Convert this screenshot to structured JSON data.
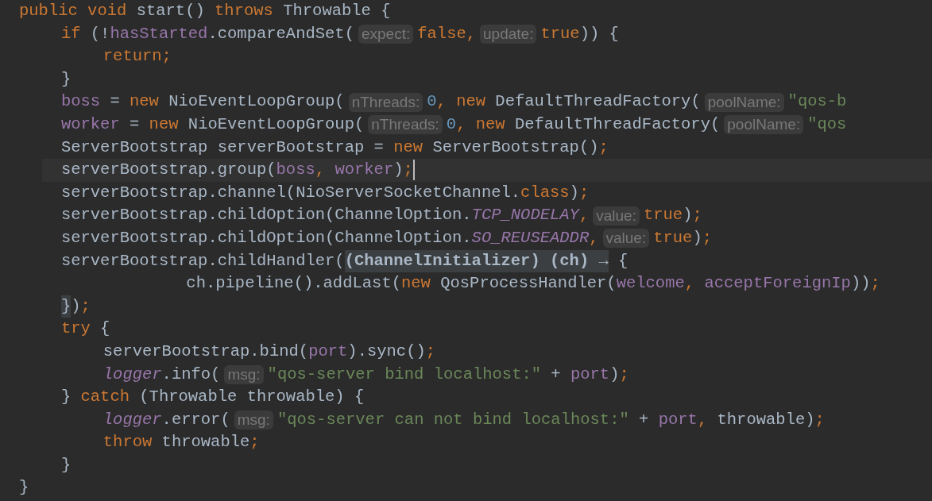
{
  "lines": [
    {
      "current": false,
      "tokens": [
        {
          "kind": "keyword",
          "text": "public void "
        },
        {
          "kind": "plain",
          "text": "start() "
        },
        {
          "kind": "keyword",
          "text": "throws "
        },
        {
          "kind": "plain",
          "text": "Throwable {"
        }
      ],
      "children": [
        {
          "current": false,
          "tokens": [
            {
              "kind": "keyword",
              "text": "if "
            },
            {
              "kind": "plain",
              "text": "(!"
            },
            {
              "kind": "field",
              "text": "hasStarted"
            },
            {
              "kind": "plain",
              "text": ".compareAndSet("
            },
            {
              "kind": "hint",
              "text": "expect:"
            },
            {
              "kind": "keyword",
              "text": "false,"
            },
            {
              "kind": "hint",
              "text": "update:"
            },
            {
              "kind": "keyword",
              "text": "true"
            },
            {
              "kind": "plain",
              "text": ")) {"
            }
          ],
          "children": [
            {
              "current": false,
              "tokens": [
                {
                  "kind": "keyword",
                  "text": "return;"
                }
              ]
            }
          ]
        },
        {
          "current": false,
          "tokens": [
            {
              "kind": "plain",
              "text": "}"
            }
          ]
        },
        {
          "current": false,
          "tokens": [
            {
              "kind": "field",
              "text": "boss"
            },
            {
              "kind": "plain",
              "text": " = "
            },
            {
              "kind": "keyword",
              "text": "new "
            },
            {
              "kind": "plain",
              "text": "NioEventLoopGroup("
            },
            {
              "kind": "hint",
              "text": "nThreads:"
            },
            {
              "kind": "number",
              "text": "0"
            },
            {
              "kind": "keyword",
              "text": ", new "
            },
            {
              "kind": "plain",
              "text": "DefaultThreadFactory("
            },
            {
              "kind": "hint",
              "text": "poolName:"
            },
            {
              "kind": "string",
              "text": "\"qos-b"
            }
          ]
        },
        {
          "current": false,
          "tokens": [
            {
              "kind": "field",
              "text": "worker"
            },
            {
              "kind": "plain",
              "text": " = "
            },
            {
              "kind": "keyword",
              "text": "new "
            },
            {
              "kind": "plain",
              "text": "NioEventLoopGroup("
            },
            {
              "kind": "hint",
              "text": "nThreads:"
            },
            {
              "kind": "number",
              "text": "0"
            },
            {
              "kind": "keyword",
              "text": ", new "
            },
            {
              "kind": "plain",
              "text": "DefaultThreadFactory("
            },
            {
              "kind": "hint",
              "text": "poolName:"
            },
            {
              "kind": "string",
              "text": "\"qos"
            }
          ]
        },
        {
          "current": false,
          "tokens": [
            {
              "kind": "plain",
              "text": "ServerBootstrap serverBootstrap = "
            },
            {
              "kind": "keyword",
              "text": "new "
            },
            {
              "kind": "plain",
              "text": "ServerBootstrap()"
            },
            {
              "kind": "keyword",
              "text": ";"
            }
          ]
        },
        {
          "current": true,
          "tokens": [
            {
              "kind": "plain",
              "text": "serverBootstrap.group("
            },
            {
              "kind": "field",
              "text": "boss"
            },
            {
              "kind": "keyword",
              "text": ", "
            },
            {
              "kind": "field",
              "text": "worker"
            },
            {
              "kind": "plain",
              "text": ")"
            },
            {
              "kind": "keyword",
              "text": ";"
            }
          ]
        },
        {
          "current": false,
          "tokens": [
            {
              "kind": "plain",
              "text": "serverBootstrap.channel(NioServerSocketChannel."
            },
            {
              "kind": "keyword",
              "text": "class"
            },
            {
              "kind": "plain",
              "text": ")"
            },
            {
              "kind": "keyword",
              "text": ";"
            }
          ]
        },
        {
          "current": false,
          "tokens": [
            {
              "kind": "plain",
              "text": "serverBootstrap.childOption(ChannelOption."
            },
            {
              "kind": "static",
              "text": "TCP_NODELAY"
            },
            {
              "kind": "keyword",
              "text": ","
            },
            {
              "kind": "hint",
              "text": "value:"
            },
            {
              "kind": "keyword",
              "text": "true"
            },
            {
              "kind": "plain",
              "text": ")"
            },
            {
              "kind": "keyword",
              "text": ";"
            }
          ]
        },
        {
          "current": false,
          "tokens": [
            {
              "kind": "plain",
              "text": "serverBootstrap.childOption(ChannelOption."
            },
            {
              "kind": "static",
              "text": "SO_REUSEADDR"
            },
            {
              "kind": "keyword",
              "text": ","
            },
            {
              "kind": "hint",
              "text": "value:"
            },
            {
              "kind": "keyword",
              "text": "true"
            },
            {
              "kind": "plain",
              "text": ")"
            },
            {
              "kind": "keyword",
              "text": ";"
            }
          ]
        },
        {
          "current": false,
          "tokens": [
            {
              "kind": "plain",
              "text": "serverBootstrap.childHandler("
            },
            {
              "kind": "fold",
              "text": "(ChannelInitializer) (ch) →"
            },
            {
              "kind": "plain",
              "text": " {"
            }
          ],
          "children": [
            {
              "current": false,
              "kind": "continuation",
              "tokens": [
                {
                  "kind": "plain",
                  "text": "ch.pipeline().addLast("
                },
                {
                  "kind": "keyword",
                  "text": "new "
                },
                {
                  "kind": "plain",
                  "text": "QosProcessHandler("
                },
                {
                  "kind": "field",
                  "text": "welcome"
                },
                {
                  "kind": "keyword",
                  "text": ", "
                },
                {
                  "kind": "field",
                  "text": "acceptForeignIp"
                },
                {
                  "kind": "plain",
                  "text": "))"
                },
                {
                  "kind": "keyword",
                  "text": ";"
                }
              ]
            }
          ]
        },
        {
          "current": false,
          "tokens": [
            {
              "kind": "match",
              "text": "}"
            },
            {
              "kind": "plain",
              "text": ")"
            },
            {
              "kind": "keyword",
              "text": ";"
            }
          ]
        },
        {
          "current": false,
          "tokens": [
            {
              "kind": "keyword",
              "text": "try "
            },
            {
              "kind": "plain",
              "text": "{"
            }
          ],
          "children": [
            {
              "current": false,
              "tokens": [
                {
                  "kind": "plain",
                  "text": "serverBootstrap.bind("
                },
                {
                  "kind": "field",
                  "text": "port"
                },
                {
                  "kind": "plain",
                  "text": ").sync()"
                },
                {
                  "kind": "keyword",
                  "text": ";"
                }
              ]
            },
            {
              "current": false,
              "tokens": [
                {
                  "kind": "static",
                  "text": "logger"
                },
                {
                  "kind": "plain",
                  "text": ".info("
                },
                {
                  "kind": "hint",
                  "text": "msg:"
                },
                {
                  "kind": "string",
                  "text": "\"qos-server bind localhost:\""
                },
                {
                  "kind": "plain",
                  "text": " + "
                },
                {
                  "kind": "field",
                  "text": "port"
                },
                {
                  "kind": "plain",
                  "text": ")"
                },
                {
                  "kind": "keyword",
                  "text": ";"
                }
              ]
            }
          ]
        },
        {
          "current": false,
          "tokens": [
            {
              "kind": "plain",
              "text": "} "
            },
            {
              "kind": "keyword",
              "text": "catch "
            },
            {
              "kind": "plain",
              "text": "(Throwable throwable) {"
            }
          ],
          "children": [
            {
              "current": false,
              "tokens": [
                {
                  "kind": "static",
                  "text": "logger"
                },
                {
                  "kind": "plain",
                  "text": ".error("
                },
                {
                  "kind": "hint",
                  "text": "msg:"
                },
                {
                  "kind": "string",
                  "text": "\"qos-server can not bind localhost:\""
                },
                {
                  "kind": "plain",
                  "text": " + "
                },
                {
                  "kind": "field",
                  "text": "port"
                },
                {
                  "kind": "keyword",
                  "text": ", "
                },
                {
                  "kind": "plain",
                  "text": "throwable)"
                },
                {
                  "kind": "keyword",
                  "text": ";"
                }
              ]
            },
            {
              "current": false,
              "tokens": [
                {
                  "kind": "keyword",
                  "text": "throw "
                },
                {
                  "kind": "plain",
                  "text": "throwable"
                },
                {
                  "kind": "keyword",
                  "text": ";"
                }
              ]
            }
          ]
        },
        {
          "current": false,
          "tokens": [
            {
              "kind": "plain",
              "text": "}"
            }
          ]
        }
      ]
    },
    {
      "current": false,
      "tokens": [
        {
          "kind": "plain",
          "text": "}"
        }
      ]
    }
  ]
}
